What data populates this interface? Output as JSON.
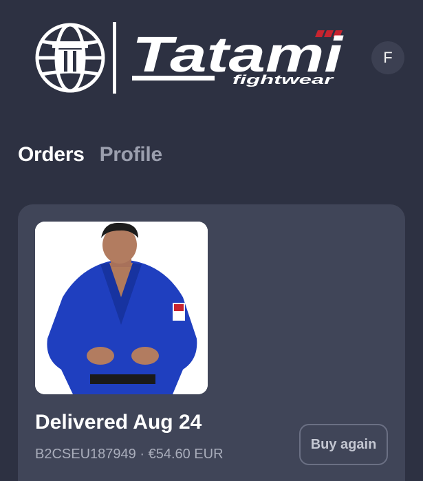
{
  "header": {
    "brand": {
      "wordmark": "Tatami",
      "tagline": "fightwear"
    },
    "avatar_initial": "F"
  },
  "tabs": [
    {
      "label": "Orders",
      "active": true
    },
    {
      "label": "Profile",
      "active": false
    }
  ],
  "orders": [
    {
      "status": "Delivered Aug 24",
      "order_number": "B2CSEU187949",
      "separator": "·",
      "total": "€54.60 EUR",
      "buy_again_label": "Buy again",
      "image_icon": "product-image-blue-gi"
    }
  ],
  "colors": {
    "background": "#2d3142",
    "card": "#404558",
    "active_tab": "#ffffff",
    "inactive_tab": "#9b9fae",
    "brand_accent": "#c8242f",
    "gi_blue": "#1f3fbf"
  }
}
